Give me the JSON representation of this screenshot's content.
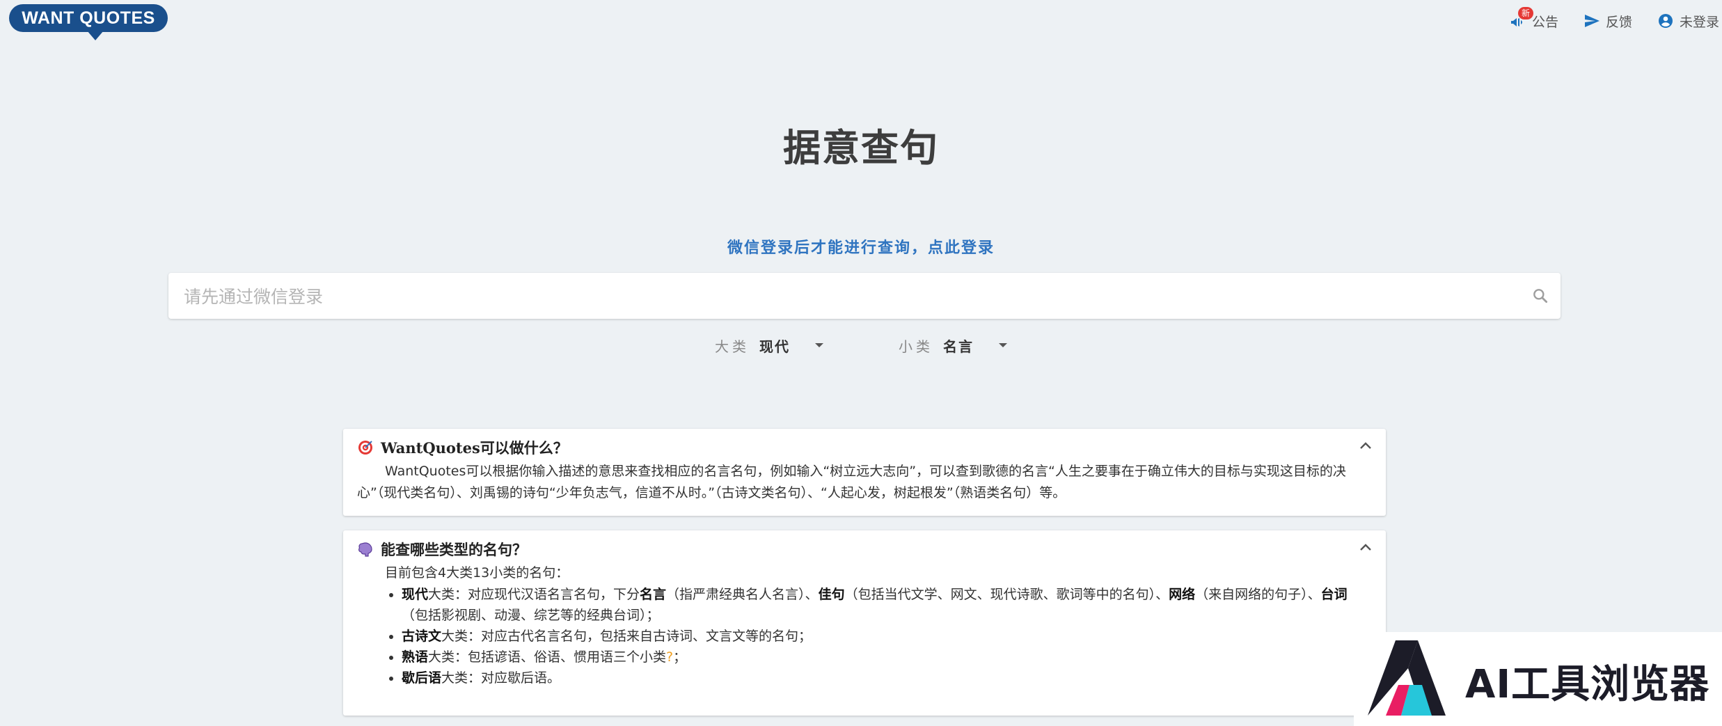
{
  "header": {
    "logo_text": "WANT QUOTES",
    "nav": {
      "announce_badge": "新",
      "announce_label": "公告",
      "feedback_label": "反馈",
      "account_label": "未登录"
    }
  },
  "hero": {
    "title": "据意查句",
    "login_prompt": "微信登录后才能进行查询，点此登录"
  },
  "search": {
    "placeholder": "请先通过微信登录"
  },
  "filters": {
    "category_label": "大类",
    "category_value": "现代",
    "subcategory_label": "小类",
    "subcategory_value": "名言"
  },
  "cards": {
    "what": {
      "title": "WantQuotes可以做什么？",
      "body": "WantQuotes可以根据你输入描述的意思来查找相应的名言名句，例如输入“树立远大志向”，可以查到歌德的名言“人生之要事在于确立伟大的目标与实现这目标的决心”（现代类名句）、刘禹锡的诗句“少年负志气，信道不从时。”（古诗文类名句）、“人起心发，树起根发”（熟语类名句）等。"
    },
    "types": {
      "title": "能查哪些类型的名句？",
      "intro": "目前包含4大类13小类的名句：",
      "modern": {
        "name": "现代",
        "t1": "大类：对应现代汉语名言名句，下分",
        "s1": "名言",
        "t2": "（指严肃经典名人名言）、",
        "s2": "佳句",
        "t3": "（包括当代文学、网文、现代诗歌、歌词等中的名句）、",
        "s3": "网络",
        "t4": "（来自网络的句子）、",
        "s4": "台词",
        "t5": "（包括影视剧、动漫、综艺等的经典台词）；"
      },
      "classical": {
        "name": "古诗文",
        "text": "大类：对应古代名言名句，包括来自古诗词、文言文等的名句；"
      },
      "idiom": {
        "name": "熟语",
        "text": "大类：包括谚语、俗语、惯用语三个小类",
        "help": "?",
        "tail": "；"
      },
      "xiehouyu": {
        "name": "歇后语",
        "text": "大类：对应歇后语。"
      }
    }
  },
  "watermark": {
    "text": "AI工具浏览器"
  },
  "colors": {
    "brand": "#1a4f8c",
    "link": "#2f74c0",
    "badge": "#e53935",
    "background": "#edf1f4"
  },
  "icons": [
    "megaphone-icon",
    "send-icon",
    "account-circle-icon",
    "search-icon",
    "target-icon",
    "brain-icon",
    "chevron-up-icon",
    "caret-down-icon"
  ]
}
